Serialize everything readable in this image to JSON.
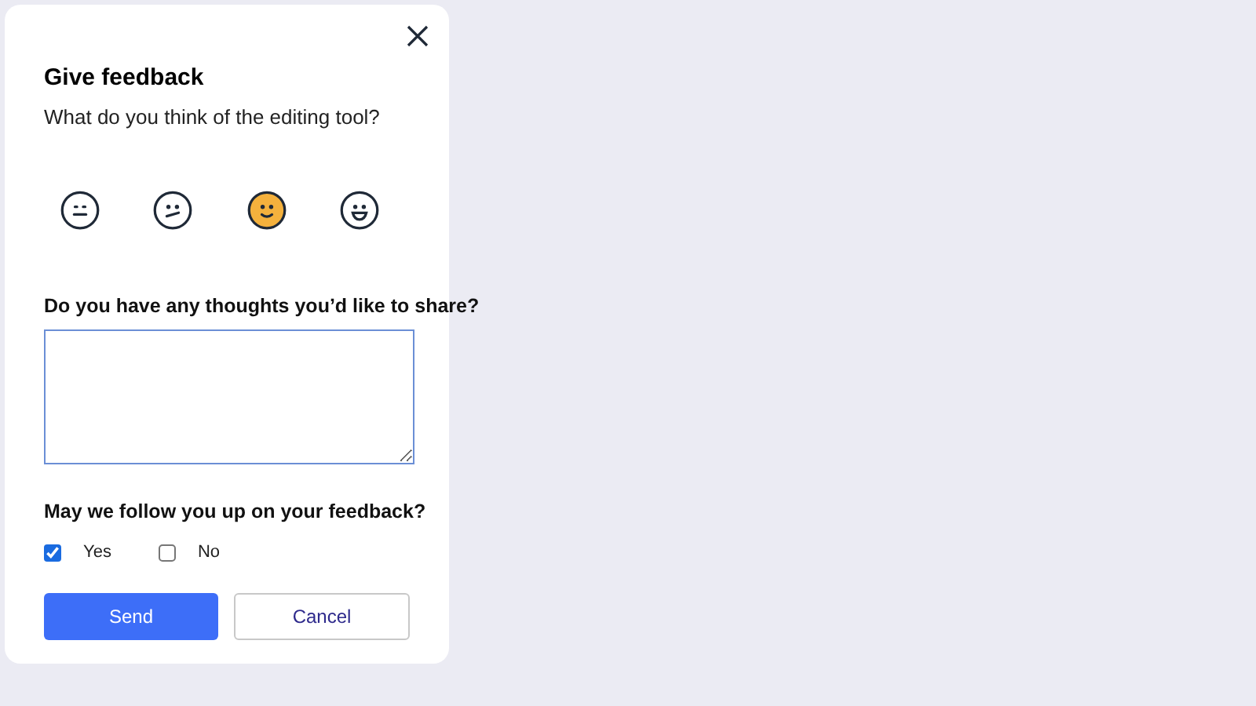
{
  "dialog": {
    "title": "Give feedback",
    "question": "What do you think of the editing tool?",
    "ratings": [
      {
        "kind": "neutral",
        "selected": false
      },
      {
        "kind": "confused",
        "selected": false
      },
      {
        "kind": "smile",
        "selected": true
      },
      {
        "kind": "grin",
        "selected": false
      }
    ],
    "comment_label": "Do you have any thoughts you’d like to share?",
    "follow_up_label": "May we follow you up on your feedback?",
    "follow_up_options": [
      {
        "label": "Yes",
        "checked": true
      },
      {
        "label": "No",
        "checked": false
      }
    ],
    "buttons": [
      {
        "label": "Send",
        "kind": "primary"
      },
      {
        "label": "Cancel",
        "kind": "secondary"
      }
    ]
  }
}
